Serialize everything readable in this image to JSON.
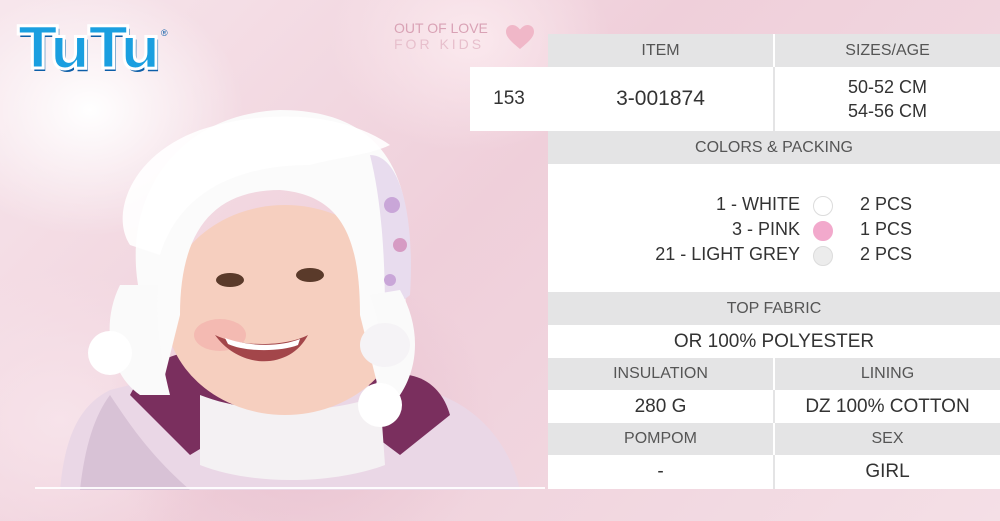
{
  "brand": {
    "logo_text": "TuTu",
    "registered": "®"
  },
  "slogan": {
    "line1": "OUT OF LOVE",
    "line2": "FOR KIDS"
  },
  "product": {
    "number": "153",
    "item_header": "ITEM",
    "item": "3-001874",
    "sizes_header": "SIZES/AGE",
    "sizes": [
      "50-52 CM",
      "54-56 CM"
    ]
  },
  "colors": {
    "header": "COLORS & PACKING",
    "items": [
      {
        "name": "1 - WHITE",
        "swatch": "#ffffff",
        "qty": "2 PCS"
      },
      {
        "name": "3 - PINK",
        "swatch": "#f2a9cc",
        "qty": "1 PCS"
      },
      {
        "name": "21 - LIGHT GREY",
        "swatch": "#ececec",
        "qty": "2 PCS"
      }
    ]
  },
  "top_fabric": {
    "header": "TOP FABRIC",
    "value": "OR 100% POLYESTER"
  },
  "insulation": {
    "header": "INSULATION",
    "value": "280 G"
  },
  "lining": {
    "header": "LINING",
    "value": "DZ 100% COTTON"
  },
  "pompom": {
    "header": "POMPOM",
    "value": "-"
  },
  "sex": {
    "header": "SEX",
    "value": "GIRL"
  },
  "theme": {
    "accent": "#1a9fe0",
    "heart": "#f0b7c8",
    "panel_header_bg": "#e4e4e5"
  }
}
